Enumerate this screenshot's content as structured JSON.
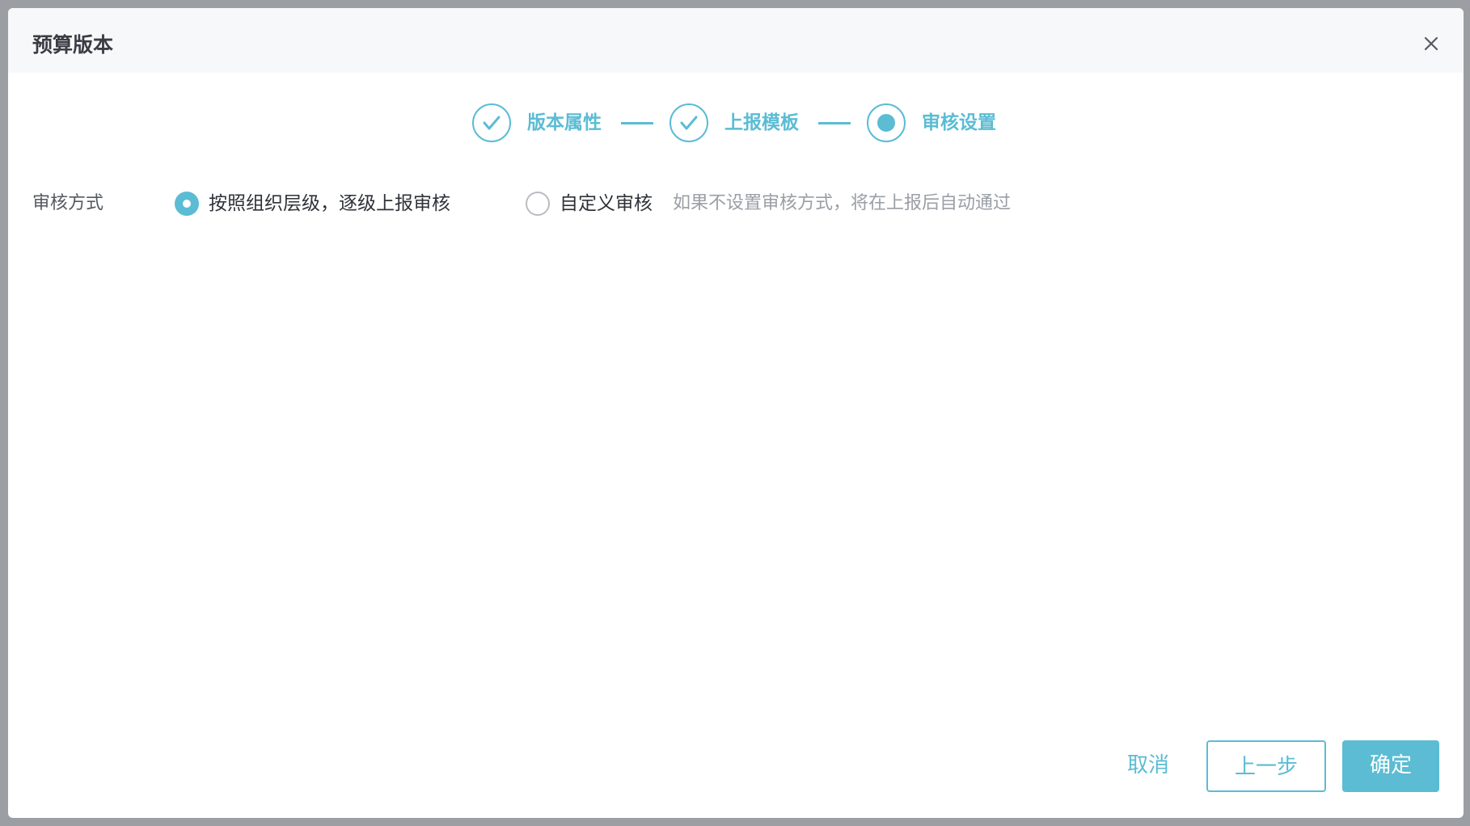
{
  "dialog": {
    "title": "预算版本",
    "close_icon": "close-icon"
  },
  "steps": [
    {
      "label": "版本属性",
      "status": "done",
      "icon": "check-icon"
    },
    {
      "label": "上报模板",
      "status": "done",
      "icon": "check-icon"
    },
    {
      "label": "审核设置",
      "status": "current",
      "icon": "dot-icon"
    }
  ],
  "form": {
    "label": "审核方式",
    "options": [
      {
        "label": "按照组织层级，逐级上报审核",
        "checked": true
      },
      {
        "label": "自定义审核",
        "checked": false
      }
    ],
    "hint": "如果不设置审核方式，将在上报后自动通过"
  },
  "footer": {
    "cancel_label": "取消",
    "prev_label": "上一步",
    "ok_label": "确定"
  },
  "colors": {
    "accent": "#5bbcd4",
    "title": "#3a3d44",
    "backdrop": "#9b9ea3"
  }
}
